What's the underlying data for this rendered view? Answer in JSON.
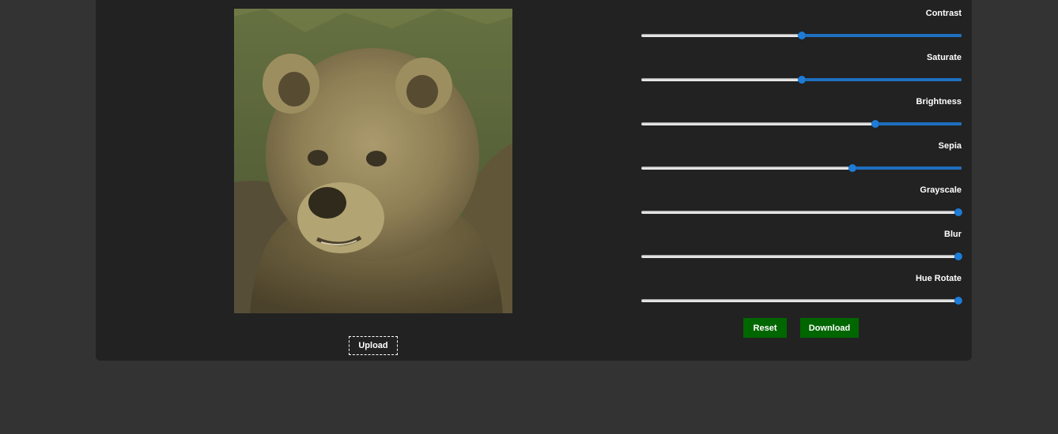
{
  "image": {
    "subject": "brown bear portrait",
    "filter_tint": "#b9a877"
  },
  "upload": {
    "label": "Upload"
  },
  "sliders": [
    {
      "key": "contrast",
      "label": "Contrast",
      "value_fraction": 0.5
    },
    {
      "key": "saturate",
      "label": "Saturate",
      "value_fraction": 0.5
    },
    {
      "key": "brightness",
      "label": "Brightness",
      "value_fraction": 0.73
    },
    {
      "key": "sepia",
      "label": "Sepia",
      "value_fraction": 0.66
    },
    {
      "key": "grayscale",
      "label": "Grayscale",
      "value_fraction": 0.99
    },
    {
      "key": "blur",
      "label": "Blur",
      "value_fraction": 0.99
    },
    {
      "key": "hue_rotate",
      "label": "Hue Rotate",
      "value_fraction": 0.99
    }
  ],
  "actions": {
    "reset_label": "Reset",
    "download_label": "Download"
  },
  "colors": {
    "page_bg": "#333333",
    "panel_bg": "#222222",
    "accent": "#1e7bd6",
    "button_green": "#006600"
  }
}
